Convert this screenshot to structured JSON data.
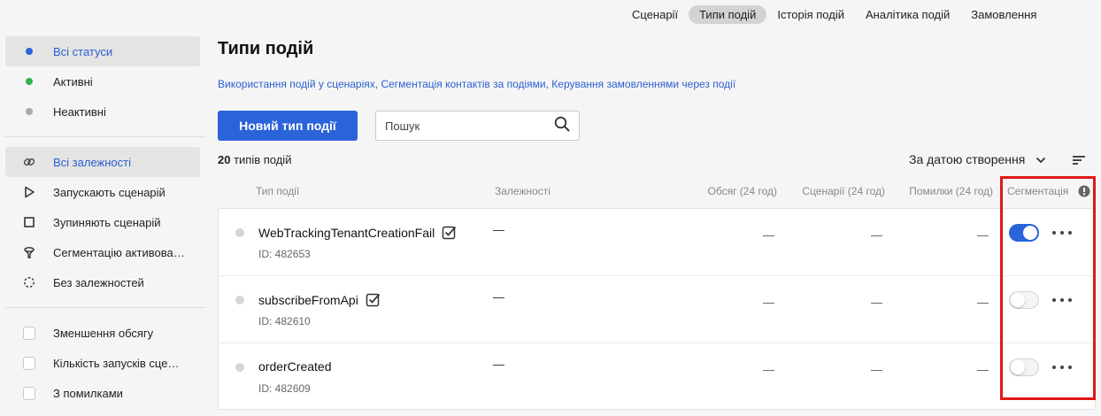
{
  "topnav": {
    "tabs": [
      {
        "label": "Сценарії",
        "active": false
      },
      {
        "label": "Типи подій",
        "active": true
      },
      {
        "label": "Історія подій",
        "active": false
      },
      {
        "label": "Аналітика подій",
        "active": false
      },
      {
        "label": "Замовлення",
        "active": false
      }
    ]
  },
  "sidebar": {
    "status_filters": [
      {
        "label": "Всі статуси",
        "icon": "dot-blue-icon",
        "color": "#2b63d9",
        "active": true
      },
      {
        "label": "Активні",
        "icon": "dot-green-icon",
        "color": "#2fb350",
        "active": false
      },
      {
        "label": "Неактивні",
        "icon": "dot-gray-icon",
        "color": "#a8a8a8",
        "active": false
      }
    ],
    "dependency_filters": [
      {
        "label": "Всі залежності",
        "icon": "link-icon",
        "active": true
      },
      {
        "label": "Запускають сценарій",
        "icon": "play-icon",
        "active": false
      },
      {
        "label": "Зупиняють сценарій",
        "icon": "stop-icon",
        "active": false
      },
      {
        "label": "Сегментацію активова…",
        "icon": "funnel-icon",
        "active": false
      },
      {
        "label": "Без залежностей",
        "icon": "dashed-circle-icon",
        "active": false
      }
    ],
    "checkbox_filters": [
      {
        "label": "Зменшення обсягу",
        "checked": false
      },
      {
        "label": "Кількість запусків сце…",
        "checked": false
      },
      {
        "label": "З помилками",
        "checked": false
      }
    ]
  },
  "main": {
    "title": "Типи подій",
    "links": [
      "Використання подій у сценаріях",
      "Сегментація контактів за подіями",
      "Керування замовленнями через події"
    ],
    "new_button": "Новий тип події",
    "search_placeholder": "Пошук",
    "count_number": "20",
    "count_text": " типів подій",
    "sort_label": "За датою створення"
  },
  "table": {
    "headers": {
      "type": "Тип події",
      "deps": "Залежності",
      "volume": "Обсяг (24 год)",
      "scenarios": "Сценарії (24 год)",
      "errors": "Помилки (24 год)",
      "segmentation": "Сегментація"
    },
    "rows": [
      {
        "name": "WebTrackingTenantCreationFail",
        "id": "ID: 482653",
        "deps": "—",
        "volume": "—",
        "scenarios": "—",
        "errors": "—",
        "segmentation": true
      },
      {
        "name": "subscribeFromApi",
        "id": "ID: 482610",
        "deps": "—",
        "volume": "—",
        "scenarios": "—",
        "errors": "—",
        "segmentation": false
      },
      {
        "name": "orderCreated",
        "id": "ID: 482609",
        "deps": "—",
        "volume": "—",
        "scenarios": "—",
        "errors": "—",
        "segmentation": false
      }
    ]
  },
  "colors": {
    "accent": "#2b63d9",
    "highlight": "#e01818",
    "link": "#2b5fd0"
  }
}
